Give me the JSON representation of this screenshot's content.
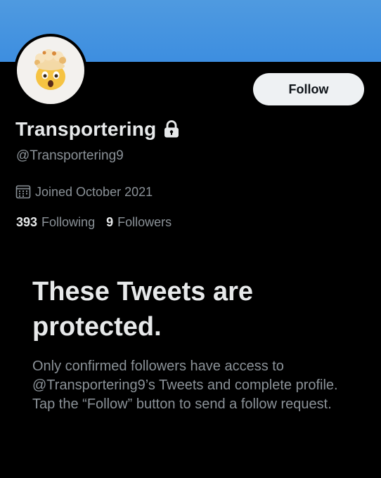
{
  "profile": {
    "display_name": "Transportering",
    "handle": "@Transportering9",
    "joined": "Joined October 2021",
    "avatar_icon": "exploding-head-emoji",
    "protected_icon": "lock-icon"
  },
  "actions": {
    "follow_label": "Follow"
  },
  "stats": {
    "following_count": "393",
    "following_label": "Following",
    "followers_count": "9",
    "followers_label": "Followers"
  },
  "protected_notice": {
    "heading": "These Tweets are protected.",
    "body": "Only confirmed followers have access to @Transportering9’s Tweets and complete profile. Tap the “Follow” button to send a follow request."
  },
  "colors": {
    "banner": "#4f9ae0",
    "background": "#000000",
    "primary_text": "#e7e9ea",
    "secondary_text": "#8b9298",
    "button_bg": "#eef1f3"
  }
}
